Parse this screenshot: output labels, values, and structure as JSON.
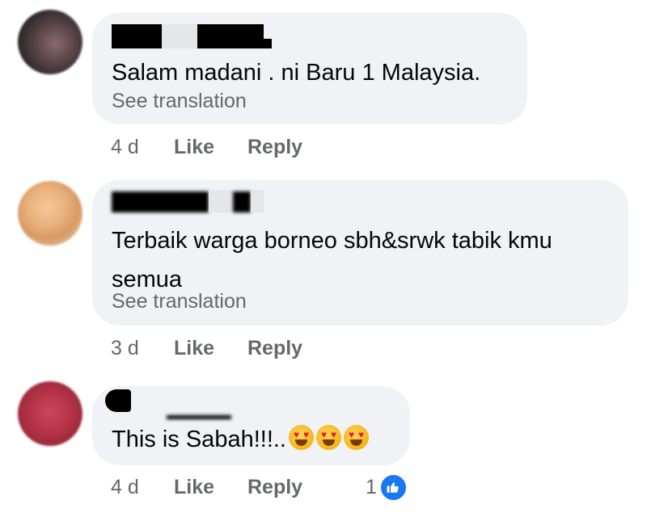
{
  "comments": [
    {
      "text": "Salam madani . ni Baru 1 Malaysia.",
      "translation_link": "See translation",
      "time": "4 d",
      "like_label": "Like",
      "reply_label": "Reply"
    },
    {
      "text": "Terbaik warga borneo sbh&srwk tabik kmu semua",
      "translation_link": "See translation",
      "time": "3 d",
      "like_label": "Like",
      "reply_label": "Reply"
    },
    {
      "text": "This is Sabah!!!..",
      "emoji_names": [
        "heart-eyes-emoji",
        "heart-eyes-emoji",
        "heart-eyes-emoji"
      ],
      "time": "4 d",
      "like_label": "Like",
      "reply_label": "Reply",
      "reaction_count": "1",
      "reaction_icon": "thumbs-up-icon"
    }
  ],
  "colors": {
    "bubble_bg": "#f0f2f5",
    "secondary_text": "#65676b",
    "like_badge": "#1877f2"
  }
}
